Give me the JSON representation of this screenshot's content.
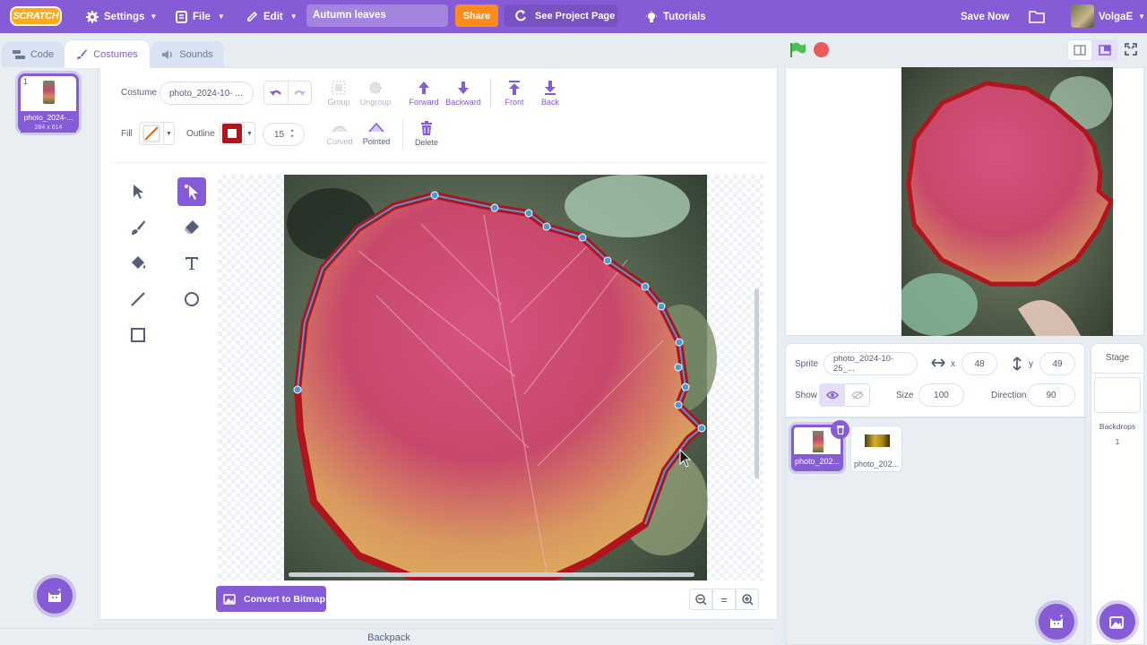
{
  "menubar": {
    "logo_text": "SCRATCH",
    "settings": "Settings",
    "file": "File",
    "edit": "Edit",
    "project_title": "Autumn leaves",
    "share": "Share",
    "see_project_page": "See Project Page",
    "tutorials": "Tutorials",
    "save_now": "Save Now",
    "username": "VolgaE"
  },
  "tabs": {
    "code": "Code",
    "costumes": "Costumes",
    "sounds": "Sounds"
  },
  "costume_list": {
    "items": [
      {
        "number": "1",
        "name": "photo_2024-...",
        "size": "284 x 614"
      }
    ]
  },
  "paint_editor": {
    "costume_label": "Costume",
    "costume_name": "photo_2024-10- ...",
    "group": "Group",
    "ungroup": "Ungroup",
    "forward": "Forward",
    "backward": "Backward",
    "front": "Front",
    "back": "Back",
    "fill_label": "Fill",
    "outline_label": "Outline",
    "outline_width": "15",
    "curved": "Curved",
    "pointed": "Pointed",
    "delete": "Delete",
    "convert_button": "Convert to Bitmap",
    "zoom_reset_symbol": "="
  },
  "sprite_info": {
    "sprite_label": "Sprite",
    "sprite_name": "photo_2024-10-25_...",
    "x_label": "x",
    "x_value": "48",
    "y_label": "y",
    "y_value": "49",
    "show_label": "Show",
    "size_label": "Size",
    "size_value": "100",
    "direction_label": "Direction",
    "direction_value": "90"
  },
  "sprites": [
    {
      "name": "photo_202..."
    },
    {
      "name": "photo_202..."
    }
  ],
  "stage_panel": {
    "title": "Stage",
    "backdrops_label": "Backdrops",
    "backdrops_count": "1"
  },
  "backpack": "Backpack",
  "colors": {
    "accent": "#855cd6",
    "share": "#ff8c1a",
    "outline": "#b0141c",
    "go_flag": "#4cbf56",
    "stop": "#ec5959"
  }
}
